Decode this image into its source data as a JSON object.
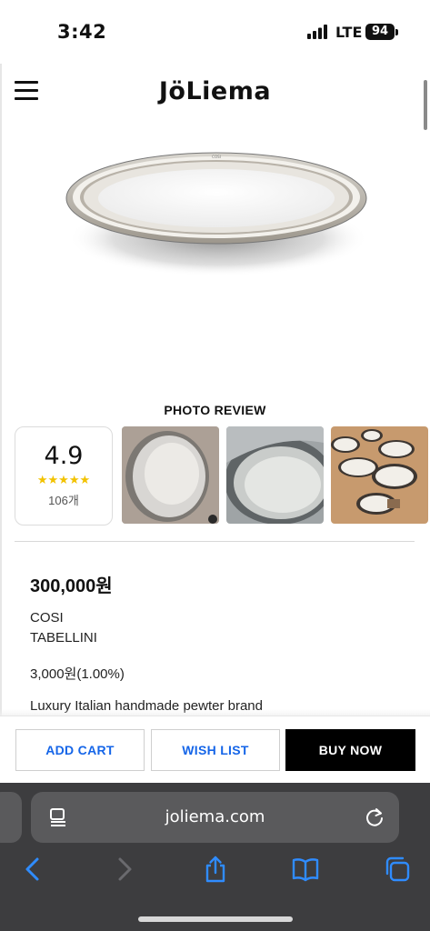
{
  "status_bar": {
    "time": "3:42",
    "network": "LTE",
    "battery": "94"
  },
  "header": {
    "logo": "JöLiema"
  },
  "photo_review": {
    "title": "PHOTO REVIEW",
    "rating": "4.9",
    "stars": "★★★★★",
    "count": "106개",
    "rating_fraction": 0.98,
    "thumbnails": [
      "photo-review-1",
      "photo-review-2",
      "photo-review-3"
    ]
  },
  "product": {
    "price": "300,000원",
    "brand_line1": "COSI",
    "brand_line2": "TABELLINI",
    "points": "3,000원(1.00%)",
    "description": "Luxury Italian handmade pewter brand"
  },
  "actions": {
    "add_cart": "ADD CART",
    "wish_list": "WISH LIST",
    "buy_now": "BUY NOW"
  },
  "browser": {
    "url": "joliema.com",
    "toolbar": [
      "back-icon",
      "forward-icon",
      "share-icon",
      "bookmarks-icon",
      "tabs-icon"
    ]
  },
  "colors": {
    "accent": "#1565e8",
    "star": "#f2c200",
    "browser_bg": "#3d3d3f"
  }
}
